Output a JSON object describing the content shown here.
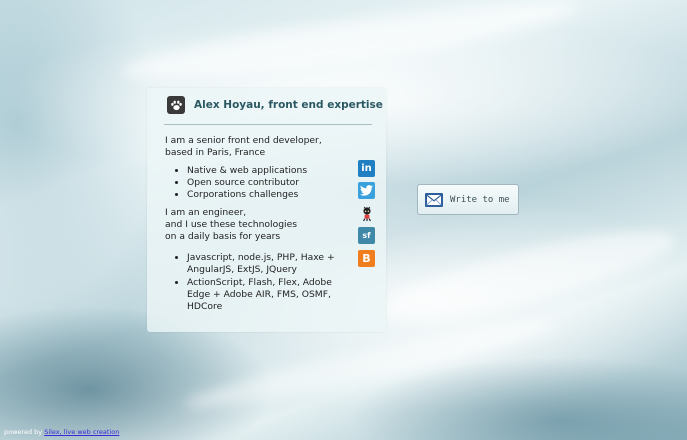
{
  "profile": {
    "title": "Alex Hoyau, front end expertise",
    "intro_line1": "I am a senior front end developer,",
    "intro_line2": "based in Paris, France",
    "roles": [
      "Native & web applications",
      "Open source contributor",
      "Corporations challenges"
    ],
    "engineer_line1": "I am an engineer,",
    "engineer_line2": "and I use these technologies",
    "engineer_line3": "on a daily basis for years",
    "technologies": [
      "Javascript, node.js, PHP, Haxe + AngularJS, ExtJS, JQuery",
      "ActionScript, Flash, Flex, Adobe Edge + Adobe AIR, FMS, OSMF, HDCore"
    ]
  },
  "social": {
    "linkedin": {
      "icon": "linkedin-icon",
      "glyph": "in",
      "color": "#1f7fc2"
    },
    "twitter": {
      "icon": "twitter-icon",
      "color": "#3aa1dd"
    },
    "github": {
      "icon": "github-octocat-icon"
    },
    "stackoverflow": {
      "icon": "stackoverflow-icon",
      "glyph": "sf",
      "color": "#3f88a8"
    },
    "blogger": {
      "icon": "blogger-icon",
      "glyph": "B",
      "color": "#f07e1e"
    }
  },
  "contact": {
    "button_label": "Write to me",
    "icon": "mail-icon"
  },
  "footer": {
    "prefix": "powered by ",
    "link_text": "Silex, live web creation"
  },
  "colors": {
    "title": "#2b5863",
    "link": "#3b2ad6"
  }
}
